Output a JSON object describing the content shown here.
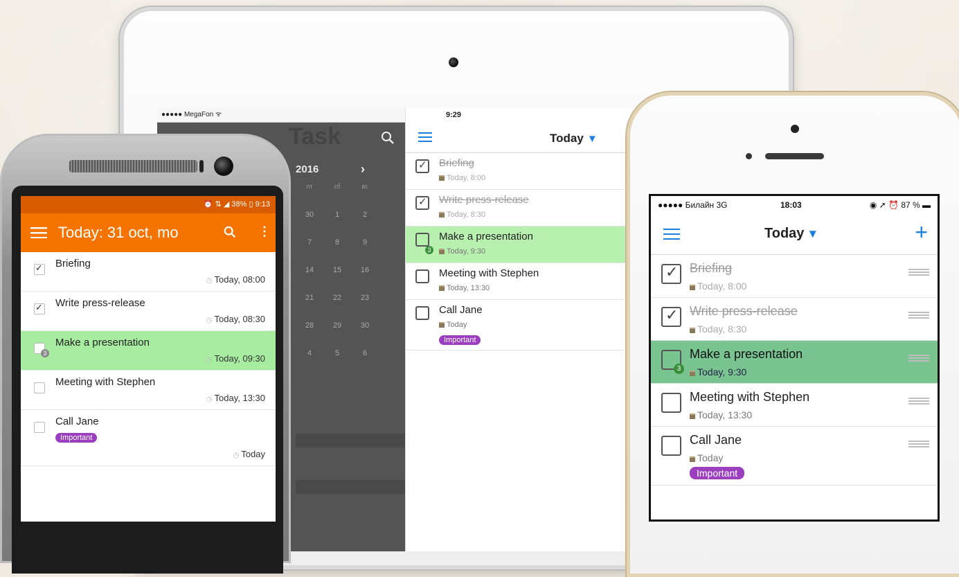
{
  "ipad": {
    "status": "●●●●● MegaFon ᯤ",
    "time": "9:29",
    "sidebar": {
      "title": "Task",
      "year": "2016",
      "next_arrow": "›",
      "weekday_headers": [
        "пт",
        "сб",
        "вс"
      ],
      "weeks": [
        [
          "30",
          "1",
          "2"
        ],
        [
          "7",
          "8",
          "9"
        ],
        [
          "14",
          "15",
          "16"
        ],
        [
          "21",
          "22",
          "23"
        ],
        [
          "28",
          "29",
          "30"
        ],
        [
          "4",
          "5",
          "6"
        ]
      ]
    },
    "nav": {
      "title": "Today",
      "dropdown": "▼"
    },
    "tasks": [
      {
        "title": "Briefing",
        "time": "Today, 8:00",
        "done": true
      },
      {
        "title": "Write press-release",
        "time": "Today, 8:30",
        "done": true
      },
      {
        "title": "Make a presentation",
        "time": "Today, 9:30",
        "subtasks": "3"
      },
      {
        "title": "Meeting with Stephen",
        "time": "Today, 13:30"
      },
      {
        "title": "Call Jane",
        "time": "Today",
        "badge": "Important"
      }
    ]
  },
  "android": {
    "status": "⏰ ⇅ ◢ 38% ▯ 9:13",
    "title": "Today: 31 oct, mo",
    "tasks": [
      {
        "title": "Briefing",
        "time": "Today, 08:00",
        "done": true
      },
      {
        "title": "Write press-release",
        "time": "Today, 08:30",
        "done": true
      },
      {
        "title": "Make a presentation",
        "time": "Today, 09:30",
        "subtasks": "3"
      },
      {
        "title": "Meeting with Stephen",
        "time": "Today, 13:30"
      },
      {
        "title": "Call Jane",
        "time": "Today",
        "badge": "Important"
      }
    ]
  },
  "iphone": {
    "status_left": "●●●●● Билайн 3G",
    "status_time": "18:03",
    "status_right": "◉ ➚ ⏰ 87 % ▬",
    "nav": {
      "title": "Today",
      "dropdown": "▼",
      "add": "+"
    },
    "tasks": [
      {
        "title": "Briefing",
        "time": "Today, 8:00",
        "done": true
      },
      {
        "title": "Write press-release",
        "time": "Today, 8:30",
        "done": true
      },
      {
        "title": "Make a presentation",
        "time": "Today, 9:30",
        "subtasks": "3"
      },
      {
        "title": "Meeting with Stephen",
        "time": "Today, 13:30"
      },
      {
        "title": "Call Jane",
        "time": "Today",
        "badge": "Important"
      }
    ]
  },
  "colors": {
    "android_orange": "#f57400",
    "highlight_green": "#a7eca1",
    "important_purple": "#9b3fc0",
    "ios_blue": "#1a7fe0"
  }
}
